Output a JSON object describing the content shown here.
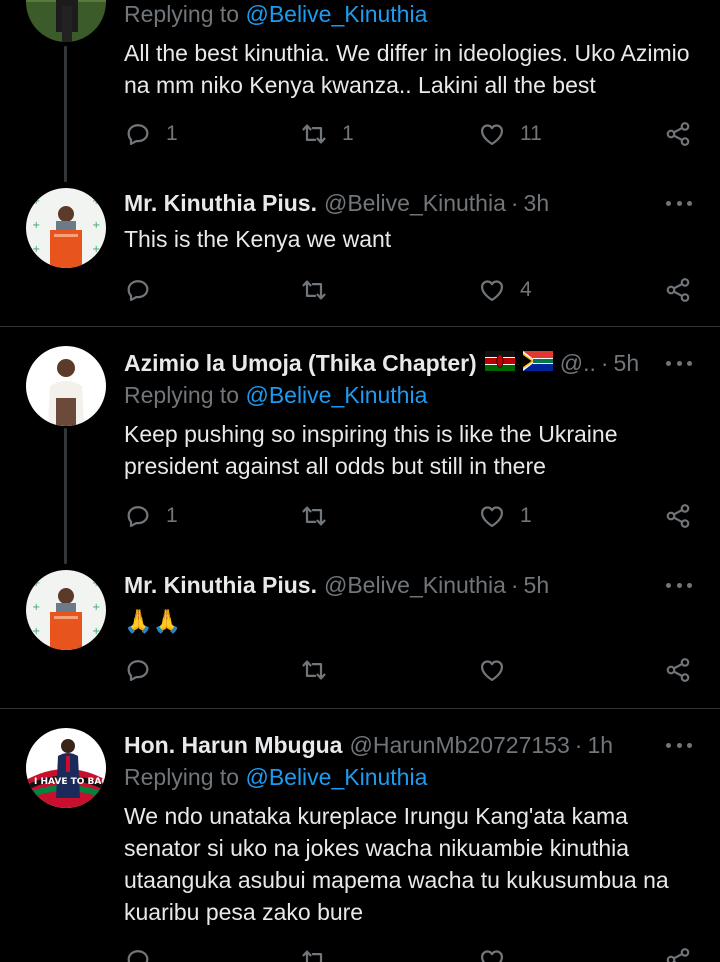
{
  "tweets": [
    {
      "replying_prefix": "Replying to",
      "replying_to": "@Belive_Kinuthia",
      "text": "All the best kinuthia. We differ in ideologies. Uko Azimio na mm niko Kenya kwanza.. Lakini all the best",
      "reply_count": "1",
      "retweet_count": "1",
      "like_count": "11"
    },
    {
      "name": "Mr. Kinuthia Pius.",
      "handle": "@Belive_Kinuthia",
      "dot": "·",
      "time": "3h",
      "text": "This is the Kenya we want",
      "reply_count": "",
      "retweet_count": "",
      "like_count": "4"
    },
    {
      "name": "Azimio la Umoja (Thika Chapter)",
      "flags": [
        "kenya-flag",
        "south-africa-flag"
      ],
      "handle": "@..",
      "dot": "·",
      "time": "5h",
      "replying_prefix": "Replying to",
      "replying_to": "@Belive_Kinuthia",
      "text": "Keep pushing so inspiring this is like the Ukraine president against all odds but still in there",
      "reply_count": "1",
      "retweet_count": "",
      "like_count": "1"
    },
    {
      "name": "Mr. Kinuthia Pius.",
      "handle": "@Belive_Kinuthia",
      "dot": "·",
      "time": "5h",
      "text": "🙏🙏",
      "reply_count": "",
      "retweet_count": "",
      "like_count": ""
    },
    {
      "name": "Hon. Harun Mbugua",
      "handle": "@HarunMb20727153",
      "dot": "·",
      "time": "1h",
      "replying_prefix": "Replying to",
      "replying_to": "@Belive_Kinuthia",
      "text": "We ndo unataka kureplace Irungu Kang'ata kama senator si uko na jokes wacha nikuambie kinuthia utaanguka asubui mapema wacha tu kukusumbua na kuaribu pesa zako bure",
      "avatar_text": "I HAVE TO BACK"
    }
  ],
  "colors": {
    "background": "#000000",
    "text": "#e7e9ea",
    "muted": "#71767b",
    "link": "#1d9bf0",
    "divider": "#2f3336"
  },
  "icons": [
    "reply-icon",
    "retweet-icon",
    "like-icon",
    "share-icon",
    "more-icon"
  ]
}
